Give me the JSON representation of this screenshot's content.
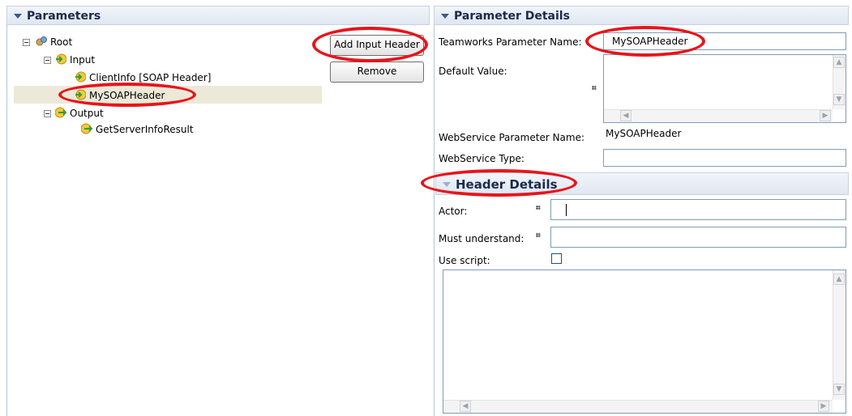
{
  "parameters_panel": {
    "title": "Parameters",
    "tree": {
      "root": "Root",
      "input": "Input",
      "client_info": "ClientInfo [SOAP Header]",
      "my_soap_header": "MySOAPHeader",
      "output": "Output",
      "get_server_info_result": "GetServerInfoResult"
    },
    "add_input_header": "Add Input Header",
    "remove": "Remove"
  },
  "details_panel": {
    "title": "Parameter Details",
    "teamworks_param_name_label": "Teamworks Parameter Name:",
    "teamworks_param_name_value": "MySOAPHeader",
    "default_value_label": "Default Value:",
    "webservice_param_name_label": "WebService Parameter Name:",
    "webservice_param_name_value": "MySOAPHeader",
    "webservice_type_label": "WebService Type:",
    "webservice_type_value": ""
  },
  "header_details": {
    "title": "Header Details",
    "actor_label": "Actor:",
    "actor_value": "",
    "must_understand_label": "Must understand:",
    "must_understand_value": "",
    "use_script_label": "Use script:",
    "use_script_checked": false
  },
  "icons": {
    "tag": "⌗"
  },
  "colors": {
    "highlight_ellipse": "#e8141b",
    "selected_row": "#ece9d8"
  }
}
